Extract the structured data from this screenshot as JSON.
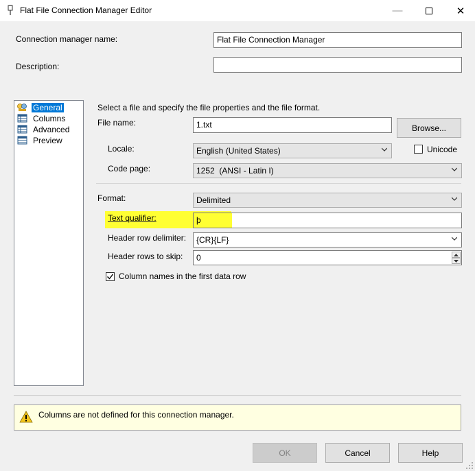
{
  "window": {
    "title": "Flat File Connection Manager Editor"
  },
  "header": {
    "name_label": "Connection manager name:",
    "name_value": "Flat File Connection Manager",
    "description_label": "Description:",
    "description_value": ""
  },
  "nav": {
    "items": [
      {
        "label": "General",
        "selected": true
      },
      {
        "label": "Columns",
        "selected": false
      },
      {
        "label": "Advanced",
        "selected": false
      },
      {
        "label": "Preview",
        "selected": false
      }
    ]
  },
  "general": {
    "instructions": "Select a file and specify the file properties and the file format.",
    "file_name_label": "File name:",
    "file_name_value": "1.txt",
    "browse_label": "Browse...",
    "locale_label": "Locale:",
    "locale_value": "English (United States)",
    "unicode_label": "Unicode",
    "unicode_checked": false,
    "code_page_label": "Code page:",
    "code_page_value": "1252  (ANSI - Latin I)",
    "format_label": "Format:",
    "format_value": "Delimited",
    "text_qualifier_label": "Text qualifier:",
    "text_qualifier_value": "þ",
    "header_row_delimiter_label": "Header row delimiter:",
    "header_row_delimiter_value": "{CR}{LF}",
    "header_rows_skip_label": "Header rows to skip:",
    "header_rows_skip_value": "0",
    "column_names_label": "Column names in the first data row",
    "column_names_checked": true
  },
  "warning": {
    "message": "Columns are not defined for this connection manager."
  },
  "footer": {
    "ok_label": "OK",
    "cancel_label": "Cancel",
    "help_label": "Help"
  },
  "colors": {
    "accent": "#0078d7",
    "highlight": "#ffff33",
    "warning_bg": "#ffffe1"
  }
}
